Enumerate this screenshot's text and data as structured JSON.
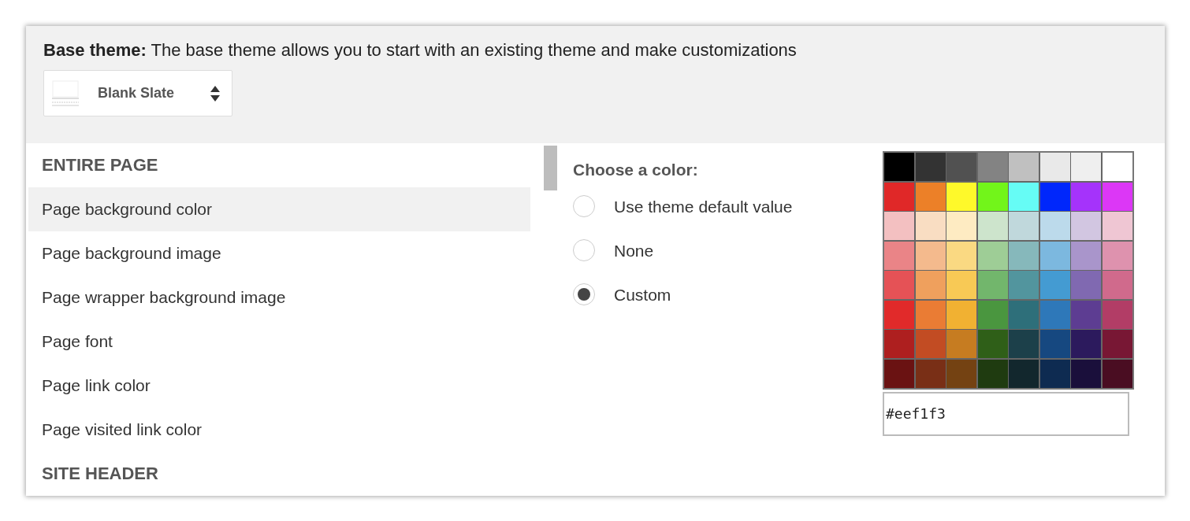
{
  "base_theme": {
    "label": "Base theme:",
    "description": "The base theme allows you to start with an existing theme and make customizations",
    "dropdown": {
      "value": "Blank Slate"
    }
  },
  "sections": [
    {
      "heading": "ENTIRE PAGE",
      "items": [
        {
          "label": "Page background color",
          "selected": true
        },
        {
          "label": "Page background image",
          "selected": false
        },
        {
          "label": "Page wrapper background image",
          "selected": false
        },
        {
          "label": "Page font",
          "selected": false
        },
        {
          "label": "Page link color",
          "selected": false
        },
        {
          "label": "Page visited link color",
          "selected": false
        }
      ]
    },
    {
      "heading": "SITE HEADER"
    }
  ],
  "color_chooser": {
    "title": "Choose a color:",
    "options": [
      {
        "label": "Use theme default value",
        "selected": false
      },
      {
        "label": "None",
        "selected": false
      },
      {
        "label": "Custom",
        "selected": true
      }
    ]
  },
  "palette": [
    [
      {
        "color": "#000000"
      },
      {
        "color": "#333333"
      },
      {
        "color": "#515151"
      },
      {
        "color": "#838383"
      },
      {
        "color": "#c0c0c0"
      },
      {
        "color": "#e9e9e9"
      },
      {
        "color": "#efefef"
      },
      {
        "color": "#ffffff"
      }
    ],
    [
      {
        "color": "#e02828"
      },
      {
        "color": "#ec8028"
      },
      {
        "color": "#fef92a"
      },
      {
        "color": "#72f51a"
      },
      {
        "color": "#66fcf5"
      },
      {
        "color": "#0027fb"
      },
      {
        "color": "#a533fb"
      },
      {
        "color": "#dc37f6"
      }
    ],
    [
      {
        "color": "#f3c0c1"
      },
      {
        "color": "#f9ddc2"
      },
      {
        "color": "#feebc2"
      },
      {
        "color": "#cde4cc"
      },
      {
        "color": "#c0d8dc"
      },
      {
        "color": "#bcdaeb"
      },
      {
        "color": "#d2c6e1"
      },
      {
        "color": "#efc6d3"
      }
    ],
    [
      {
        "color": "#ea8487"
      },
      {
        "color": "#f4ba8d"
      },
      {
        "color": "#fad982"
      },
      {
        "color": "#9ecd96"
      },
      {
        "color": "#86b8bb"
      },
      {
        "color": "#7cb8df"
      },
      {
        "color": "#a995cb"
      },
      {
        "color": "#de92ae"
      }
    ],
    [
      {
        "color": "#e55256"
      },
      {
        "color": "#efa05d"
      },
      {
        "color": "#f8c955"
      },
      {
        "color": "#72b66c"
      },
      {
        "color": "#52959e"
      },
      {
        "color": "#449bd2"
      },
      {
        "color": "#8069b1"
      },
      {
        "color": "#d06a8c"
      }
    ],
    [
      {
        "color": "#e12a2a"
      },
      {
        "color": "#ea7c34"
      },
      {
        "color": "#f1b132"
      },
      {
        "color": "#4a963f"
      },
      {
        "color": "#2e6f7a"
      },
      {
        "color": "#2e78b9"
      },
      {
        "color": "#5d3d92"
      },
      {
        "color": "#b23d66"
      }
    ],
    [
      {
        "color": "#ae1f1f"
      },
      {
        "color": "#c24c23"
      },
      {
        "color": "#c67c21"
      },
      {
        "color": "#2f5f18"
      },
      {
        "color": "#1c404a"
      },
      {
        "color": "#164880"
      },
      {
        "color": "#2c1a5d"
      },
      {
        "color": "#781734"
      }
    ],
    [
      {
        "color": "#6a1212"
      },
      {
        "color": "#792f16"
      },
      {
        "color": "#744212"
      },
      {
        "color": "#1f3b10"
      },
      {
        "color": "#12272d"
      },
      {
        "color": "#0e2b51"
      },
      {
        "color": "#1a0f3b"
      },
      {
        "color": "#4a0d22"
      }
    ]
  ],
  "hex_input": {
    "value": "#eef1f3"
  }
}
